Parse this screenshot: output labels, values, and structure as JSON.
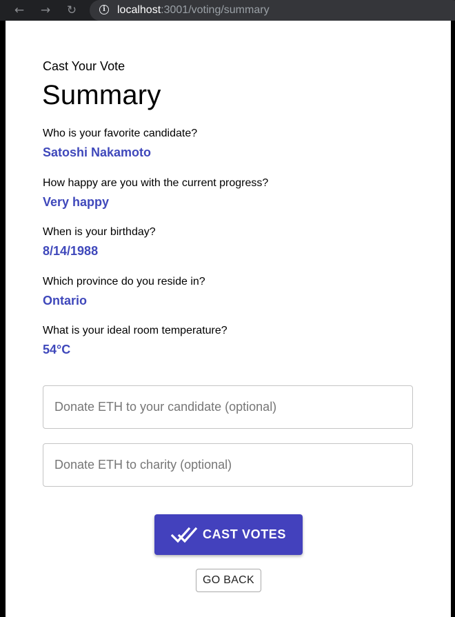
{
  "browser": {
    "url_host": "localhost",
    "url_path": ":3001/voting/summary",
    "back_icon": "←",
    "forward_icon": "→",
    "reload_icon": "↻",
    "info_icon": "i"
  },
  "header": {
    "kicker": "Cast Your Vote",
    "title": "Summary"
  },
  "summary": [
    {
      "question": "Who is your favorite candidate?",
      "answer": "Satoshi Nakamoto"
    },
    {
      "question": "How happy are you with the current progress?",
      "answer": "Very happy"
    },
    {
      "question": "When is your birthday?",
      "answer": "8/14/1988"
    },
    {
      "question": "Which province do you reside in?",
      "answer": "Ontario"
    },
    {
      "question": "What is your ideal room temperature?",
      "answer": "54°C"
    }
  ],
  "donations": {
    "candidate_placeholder": "Donate ETH to your candidate (optional)",
    "candidate_value": "",
    "charity_placeholder": "Donate ETH to charity (optional)",
    "charity_value": ""
  },
  "actions": {
    "cast_label": "CAST VOTES",
    "cast_icon": "double-check-icon",
    "back_label": "GO BACK"
  },
  "colors": {
    "accent": "#4341bd",
    "answer": "#3f48bb",
    "browser_bg": "#202124"
  }
}
